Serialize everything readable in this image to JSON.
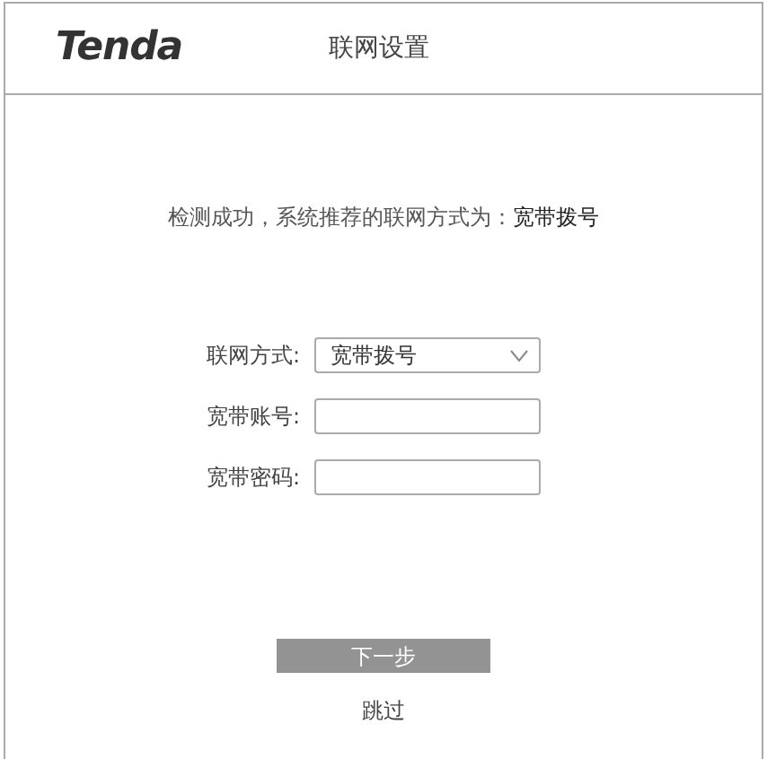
{
  "header": {
    "logo": "Tenda",
    "title": "联网设置"
  },
  "message": "检测成功，系统推荐的联网方式为：**宽带拨号**",
  "form": [
    {
      "kind": "select",
      "label": "联网方式:",
      "value": "宽带拨号"
    },
    {
      "kind": "text",
      "label": "宽带账号:"
    },
    {
      "kind": "text",
      "label": "宽带密码:"
    }
  ],
  "next_button": "下一步",
  "skip_link": "跳过"
}
